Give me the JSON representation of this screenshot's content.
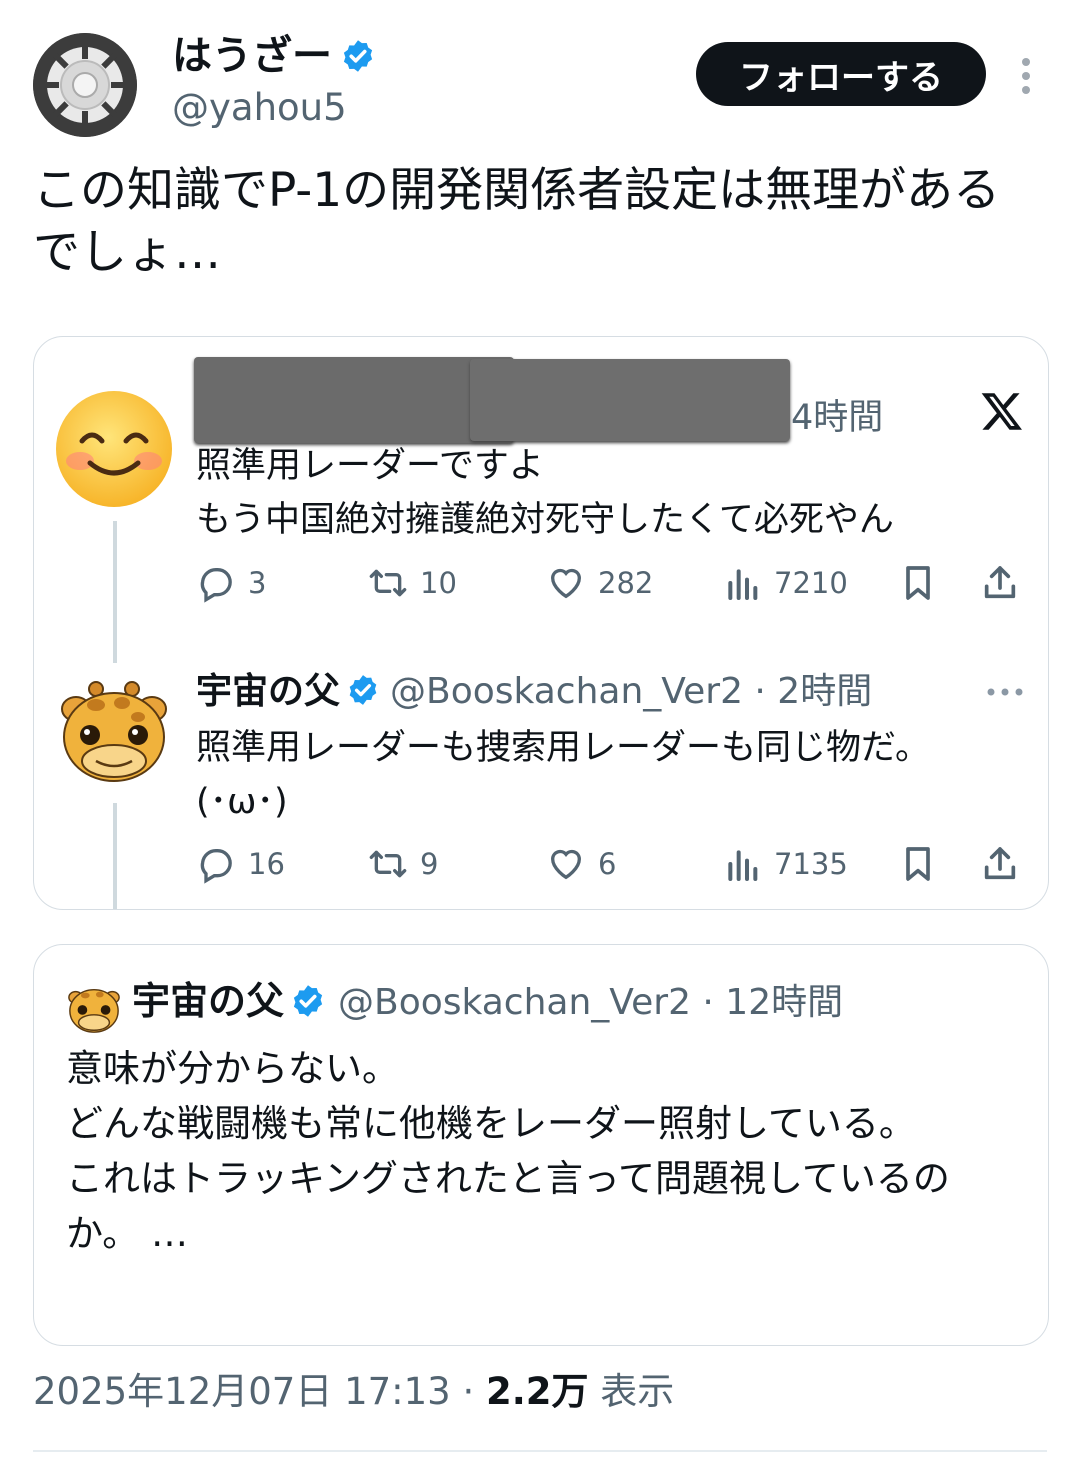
{
  "header": {
    "display_name": "はうざー",
    "handle": "@yahou5",
    "follow_label": "フォローする"
  },
  "tweet": {
    "text": "この知識でP-1の開発関係者設定は無理があるでしょ…"
  },
  "screenshot": {
    "first_reply": {
      "time": "4時間",
      "text": "照準用レーダーですよ\nもう中国絶対擁護絶対死守したくて必死やん",
      "replies": "3",
      "retweets": "10",
      "likes": "282",
      "views": "7210"
    },
    "second_reply": {
      "name": "宇宙の父",
      "handle_time": "@Booskachan_Ver2 · 2時間",
      "text": "照準用レーダーも捜索用レーダーも同じ物だ。\n(･ω･)",
      "replies": "16",
      "retweets": "9",
      "likes": "6",
      "views": "7135"
    }
  },
  "quote": {
    "name": "宇宙の父",
    "handle_time": "@Booskachan_Ver2 · 12時間",
    "text": "意味が分からない。\nどんな戦闘機も常に他機をレーダー照射している。\nこれはトラッキングされたと言って問題視しているのか。 …"
  },
  "footer": {
    "timestamp": "2025年12月07日 17:13 · ",
    "views_count": "2.2万",
    "views_label": " 表示"
  },
  "colors": {
    "text": "#0f1419",
    "secondary": "#536471",
    "verified": "#1d9bf0",
    "border": "#d6dde3",
    "redaction": "#6b6b6b"
  },
  "icons": [
    "verified-icon",
    "more-vertical-icon",
    "x-logo-icon",
    "reply-icon",
    "retweet-icon",
    "like-icon",
    "views-icon",
    "bookmark-icon",
    "share-icon",
    "more-horizontal-icon"
  ]
}
